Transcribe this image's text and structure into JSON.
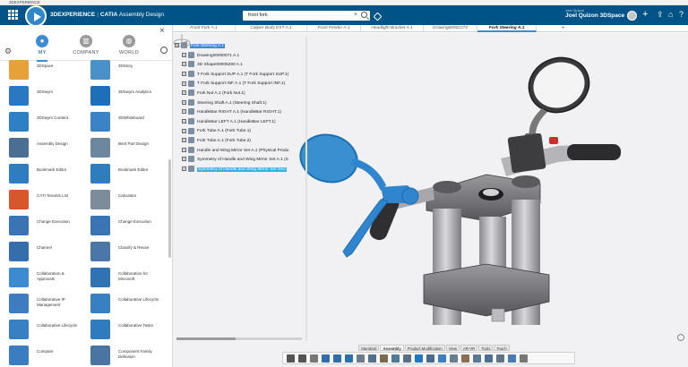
{
  "os": {
    "title": "3DEXPERIENCE"
  },
  "header": {
    "brand_main": "3DEXPERIENCE",
    "brand_sep": "|",
    "brand_app": "CATIA",
    "brand_role": "Assembly Design",
    "search_value": "front fork",
    "user_caption": "Joel Quizon",
    "user_name": "Joel Quizon 3DSpace",
    "icons": [
      "menu-icon",
      "compass-logo-icon",
      "tag-icon",
      "avatar",
      "plus-icon",
      "share-icon",
      "home-icon",
      "help-icon"
    ]
  },
  "left_panel": {
    "tabs": [
      {
        "label": "MY",
        "icon": "person-icon"
      },
      {
        "label": "COMPANY",
        "icon": "building-icon"
      },
      {
        "label": "WORLD",
        "icon": "globe-icon"
      }
    ],
    "apps": [
      {
        "label": "3DSpace",
        "color": "#e7a13a"
      },
      {
        "label": "3DStory",
        "color": "#4a90c9"
      },
      {
        "label": "3DSwym",
        "color": "#2b78c2"
      },
      {
        "label": "3DSwym Analytics",
        "color": "#1c6fb8"
      },
      {
        "label": "3DSwym Content",
        "color": "#2d80c4"
      },
      {
        "label": "3DWhiteboard",
        "color": "#3a83c7"
      },
      {
        "label": "Assembly Design",
        "color": "#4b6e95"
      },
      {
        "label": "Bent Part Design",
        "color": "#6d879f"
      },
      {
        "label": "Bookmark Editor",
        "color": "#2e7dc0"
      },
      {
        "label": "Bookmark Editor",
        "color": "#2e7dc0"
      },
      {
        "label": "CATI Tenants List",
        "color": "#d8562c"
      },
      {
        "label": "Calculator",
        "color": "#7c8c9a"
      },
      {
        "label": "Change Execution",
        "color": "#3b74b4"
      },
      {
        "label": "Change Execution",
        "color": "#3b74b4"
      },
      {
        "label": "Channel",
        "color": "#356eab"
      },
      {
        "label": "Classify & Reuse",
        "color": "#4b76a8"
      },
      {
        "label": "Collaboration & Approvals",
        "color": "#3c8ad0"
      },
      {
        "label": "Collaboration for Microsoft",
        "color": "#2f73b5"
      },
      {
        "label": "Collaborative IP Management",
        "color": "#3d7cc0"
      },
      {
        "label": "Collaborative Lifecycle",
        "color": "#3880c4"
      },
      {
        "label": "Collaborative Lifecycle",
        "color": "#3880c4"
      },
      {
        "label": "Collaborative Tasks",
        "color": "#2f7bc0"
      },
      {
        "label": "Compare",
        "color": "#3c7dbf"
      },
      {
        "label": "Component Family Definition",
        "color": "#4a75a3"
      }
    ]
  },
  "doc_tabs": [
    {
      "label": "Front Fork A.1",
      "active": false
    },
    {
      "label": "Caliper Body EXT A.1",
      "active": false
    },
    {
      "label": "Front Fender A.1",
      "active": false
    },
    {
      "label": "Headlight Bracket A.1",
      "active": false
    },
    {
      "label": "Drawing00002273",
      "active": false
    },
    {
      "label": "Fork Steering A.1",
      "active": true
    }
  ],
  "tree": [
    {
      "label": "Fork Steering A.1",
      "kind": "root",
      "indent": 0
    },
    {
      "label": "Drawing00000071 A.1",
      "kind": "node",
      "indent": 1
    },
    {
      "label": "3D Shape00005290 A.1",
      "kind": "node",
      "indent": 1
    },
    {
      "label": "T Fork Support SUP A.1 (T Fork Support SUP.1)",
      "kind": "node",
      "indent": 1
    },
    {
      "label": "T Fork Support INF A.1 (T Fork Support INF.1)",
      "kind": "node",
      "indent": 1
    },
    {
      "label": "Fork Nut A.1 (Fork Nut.1)",
      "kind": "node",
      "indent": 1
    },
    {
      "label": "Steering Shaft A.1 (Steering Shaft.1)",
      "kind": "node",
      "indent": 1
    },
    {
      "label": "HandleBar RIGHT A.1 (HandleBar RIGHT.1)",
      "kind": "node",
      "indent": 1
    },
    {
      "label": "HandleBar LEFT A.1 (HandleBar LEFT.1)",
      "kind": "node",
      "indent": 1
    },
    {
      "label": "Fork Tube A.1 (Fork Tube.1)",
      "kind": "node",
      "indent": 1
    },
    {
      "label": "Fork Tube A.1 (Fork Tube.2)",
      "kind": "node",
      "indent": 1
    },
    {
      "label": "Handle and Wing Mirror Set A.1 (Physical Produ",
      "kind": "node",
      "indent": 1
    },
    {
      "label": "Symmetry of Handle and Wing Mirror Set A.1 (S",
      "kind": "node",
      "indent": 1
    },
    {
      "label": "Symmetry of Handle and Wing Mirror Set Geo",
      "kind": "selected",
      "indent": 1
    }
  ],
  "section_tabs": [
    {
      "label": "Standard",
      "active": false
    },
    {
      "label": "Assembly",
      "active": true
    },
    {
      "label": "Product Modification",
      "active": false
    },
    {
      "label": "View",
      "active": false
    },
    {
      "label": "AR-VR",
      "active": false
    },
    {
      "label": "Tools",
      "active": false
    },
    {
      "label": "Touch",
      "active": false
    }
  ],
  "action_icons": [
    {
      "name": "cut-icon",
      "color": "#555"
    },
    {
      "name": "copy-icon",
      "color": "#555"
    },
    {
      "name": "paste-icon",
      "color": "#777"
    },
    {
      "name": "undo-icon",
      "color": "#2f6ea8"
    },
    {
      "name": "redo-icon",
      "color": "#2f6ea8"
    },
    {
      "name": "update-icon",
      "color": "#2f6ea8"
    },
    {
      "name": "insert-icon",
      "color": "#6b7c8d"
    },
    {
      "name": "engineering-connection-icon",
      "color": "#55708a"
    },
    {
      "name": "fix-icon",
      "color": "#7a6a4f"
    },
    {
      "name": "snap-icon",
      "color": "#4f7a9a"
    },
    {
      "name": "explode-icon",
      "color": "#5a6e85"
    },
    {
      "name": "manipulate-icon",
      "color": "#1e78c2"
    },
    {
      "name": "constraint-icon",
      "color": "#4a6a8f"
    },
    {
      "name": "contact-icon",
      "color": "#3f7fbf"
    },
    {
      "name": "measure-icon",
      "color": "#6a7d90"
    },
    {
      "name": "clash-icon",
      "color": "#8a6f55"
    },
    {
      "name": "section-icon",
      "color": "#5b7896"
    },
    {
      "name": "render-icon",
      "color": "#4e6f91"
    },
    {
      "name": "pattern-icon",
      "color": "#607485"
    },
    {
      "name": "symmetry-icon",
      "color": "#4a7ab0"
    },
    {
      "name": "more-icon",
      "color": "#777"
    }
  ]
}
